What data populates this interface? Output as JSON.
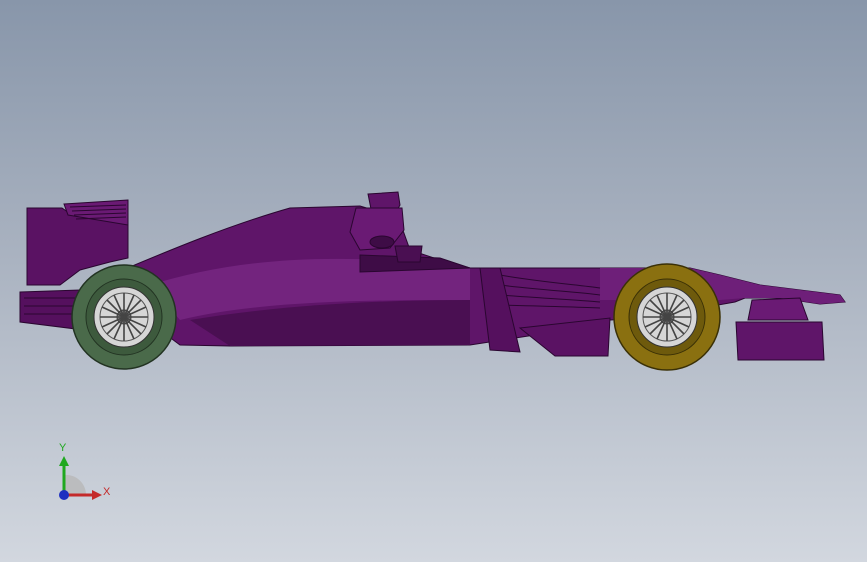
{
  "viewport": {
    "background_top": "#8896aa",
    "background_bottom": "#d2d7df"
  },
  "model": {
    "body_color": "#5f1569",
    "body_highlight": "#7a2a86",
    "body_shadow": "#3e0c46",
    "rear_tire_color": "#4a6a4a",
    "front_tire_color": "#8a7010",
    "wheel_rim_color": "#c8c8c8"
  },
  "triad": {
    "y_label": "Y",
    "x_label": "X",
    "y_color": "#1fa81f",
    "x_color": "#c42a2a",
    "z_color": "#1d2fc0"
  }
}
